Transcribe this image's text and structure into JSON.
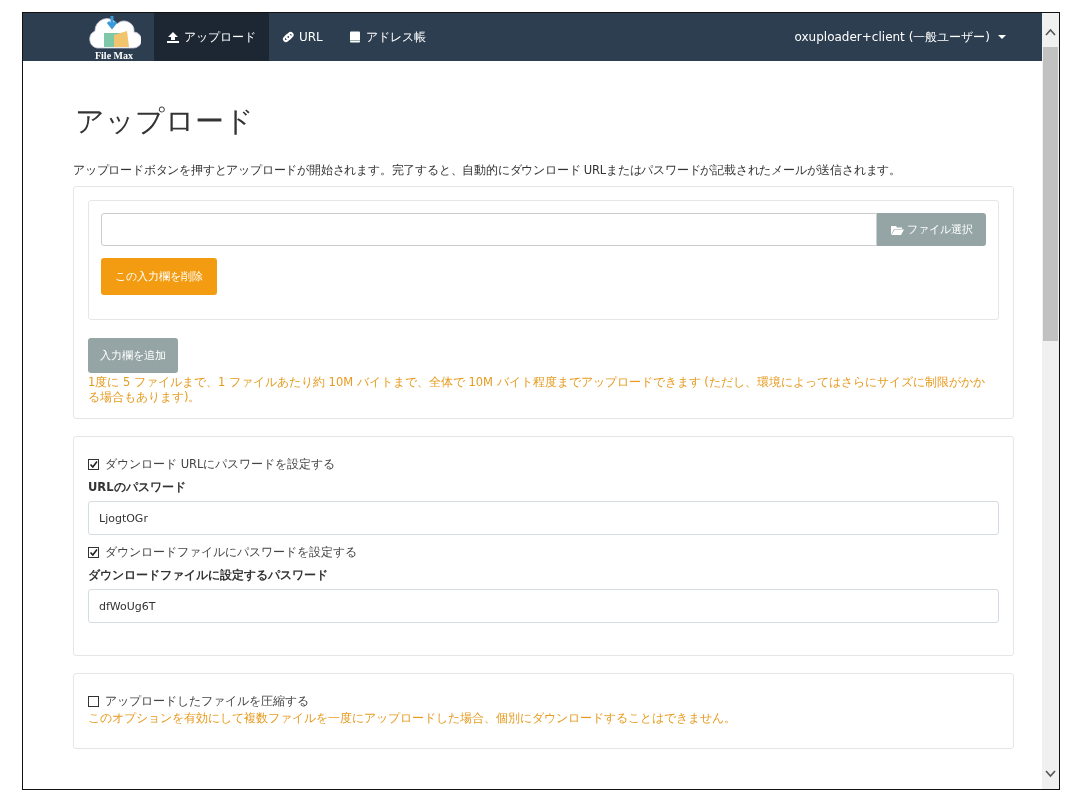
{
  "nav": {
    "logo_text": "File Max",
    "tabs": [
      {
        "label": "アップロード",
        "selected": true
      },
      {
        "label": "URL",
        "selected": false
      },
      {
        "label": "アドレス帳",
        "selected": false
      }
    ],
    "user_menu": "oxuploader+client (一般ユーザー)"
  },
  "title": "アップロード",
  "description": "アップロードボタンを押すとアップロードが開始されます。完了すると、自動的にダウンロード URLまたはパスワードが記載されたメールが送信されます。",
  "upload_panel": {
    "file_rows": [
      {
        "browse_button": "ファイル選択",
        "remove_button": "この入力欄を削除"
      }
    ],
    "add_button": "入力欄を追加",
    "note": "1度に 5 ファイルまで、1 ファイルあたり約 10M バイトまで、全体で 10M バイト程度までアップロードできます (ただし、環境によってはさらにサイズに制限がかかる場合もあります)。"
  },
  "password_panel": {
    "items": [
      {
        "kind": "checkbox",
        "label": "ダウンロード URLにパスワードを設定する",
        "checked": true
      },
      {
        "kind": "field",
        "label": "URLのパスワード",
        "value": "LjogtOGr"
      },
      {
        "kind": "checkbox",
        "label": "ダウンロードファイルにパスワードを設定する",
        "checked": true
      },
      {
        "kind": "field",
        "label": "ダウンロードファイルに設定するパスワード",
        "value": "dfWoUg6T"
      }
    ]
  },
  "compress_panel": {
    "items": [
      {
        "kind": "checkbox",
        "label": "アップロードしたファイルを圧縮する",
        "checked": false
      },
      {
        "kind": "note",
        "label": "このオプションを有効にして複数ファイルを一度にアップロードした場合、個別にダウンロードすることはできません。"
      }
    ]
  }
}
